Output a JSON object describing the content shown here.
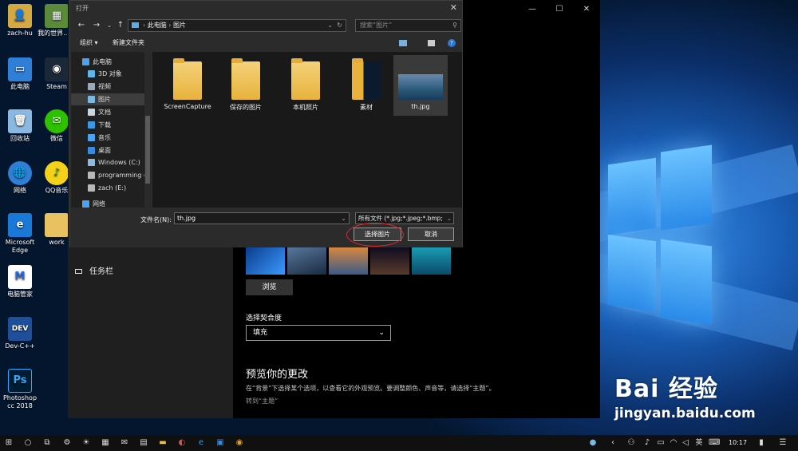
{
  "desktop": {
    "icons": [
      {
        "label": "zach-hu",
        "icon": "user-folder-icon"
      },
      {
        "label": "我的世界...器",
        "icon": "minecraft-icon"
      },
      {
        "label": "此电脑",
        "icon": "computer-icon"
      },
      {
        "label": "Steam",
        "icon": "steam-icon"
      },
      {
        "label": "回收站",
        "icon": "recycle-bin-icon"
      },
      {
        "label": "微信",
        "icon": "wechat-icon"
      },
      {
        "label": "网络",
        "icon": "network-icon"
      },
      {
        "label": "QQ音乐",
        "icon": "qq-music-icon"
      },
      {
        "label": "Microsoft Edge",
        "icon": "edge-icon"
      },
      {
        "label": "work",
        "icon": "folder-icon"
      },
      {
        "label": "电脑管家",
        "icon": "pc-manager-icon"
      },
      {
        "label": "Dev-C++",
        "icon": "dev-cpp-icon"
      },
      {
        "label": "Photoshop cc 2018",
        "icon": "photoshop-icon"
      }
    ]
  },
  "settings": {
    "taskbar_item": "任务栏",
    "browse_button": "浏览",
    "fit_label": "选择契合度",
    "fit_value": "填充",
    "preview_heading": "预览你的更改",
    "preview_desc": "在“背景”下选择某个选项，以查看它的外观预览。要调整颜色、声音等，请选择“主题”。",
    "theme_link": "转到“主题”"
  },
  "dialog": {
    "title": "打开",
    "breadcrumb": [
      "此电脑",
      "图片"
    ],
    "search_placeholder": "搜索“图片”",
    "organize": "组织 ▾",
    "new_folder": "新建文件夹",
    "nav_items": [
      {
        "label": "此电脑",
        "icon": "computer-icon",
        "color": "#4aa3f0"
      },
      {
        "label": "3D 对象",
        "icon": "cube-icon",
        "color": "#5fb8e8"
      },
      {
        "label": "视频",
        "icon": "video-icon",
        "color": "#9aa8b8"
      },
      {
        "label": "图片",
        "icon": "pictures-icon",
        "color": "#7ab8e0"
      },
      {
        "label": "文档",
        "icon": "document-icon",
        "color": "#c9d4e0"
      },
      {
        "label": "下载",
        "icon": "download-icon",
        "color": "#3a9ae8"
      },
      {
        "label": "音乐",
        "icon": "music-icon",
        "color": "#4aa3f0"
      },
      {
        "label": "桌面",
        "icon": "desktop-icon",
        "color": "#3a8ae0"
      },
      {
        "label": "Windows (C:)",
        "icon": "drive-icon",
        "color": "#8fb8dc"
      },
      {
        "label": "programming (",
        "icon": "drive-icon",
        "color": "#b8b8b8"
      },
      {
        "label": "zach (E:)",
        "icon": "drive-icon",
        "color": "#b8b8b8"
      },
      {
        "label": "网络",
        "icon": "network-icon",
        "color": "#4aa3f0"
      }
    ],
    "files": [
      {
        "name": "ScreenCapture",
        "type": "folder"
      },
      {
        "name": "保存的图片",
        "type": "folder"
      },
      {
        "name": "本机照片",
        "type": "folder"
      },
      {
        "name": "素材",
        "type": "folder-dark"
      },
      {
        "name": "th.jpg",
        "type": "image"
      }
    ],
    "filename_label": "文件名(N):",
    "filename_value": "th.jpg",
    "filetype_value": "所有文件 (*.jpg;*.jpeg;*.bmp;",
    "select_button": "选择图片",
    "cancel_button": "取消"
  },
  "taskbar": {
    "clock": "10:17",
    "ime": "英"
  },
  "watermark": {
    "brand": "Bai 经验",
    "url": "jingyan.baidu.com"
  }
}
